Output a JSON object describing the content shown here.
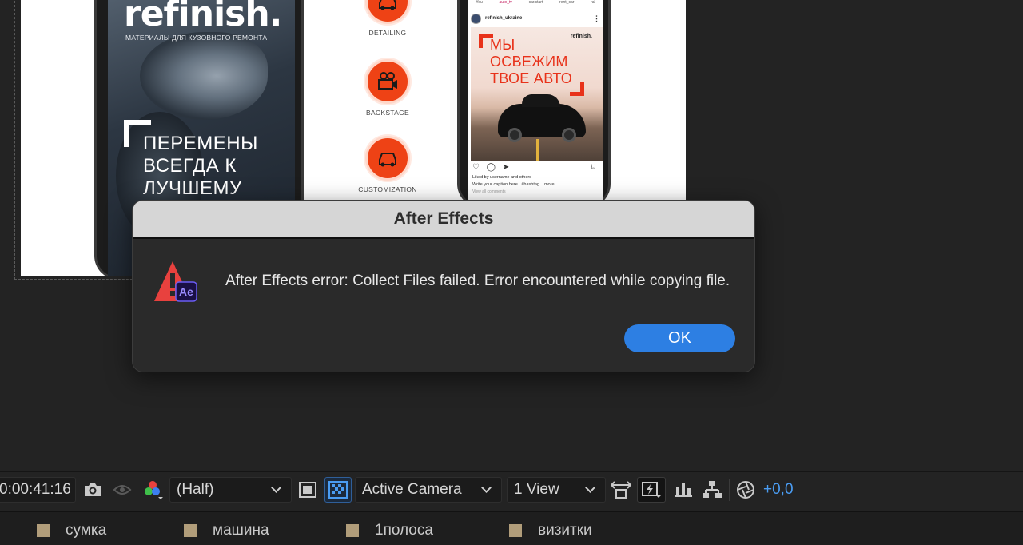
{
  "composition": {
    "phone1": {
      "brand": "refinish.",
      "subtitle": "МАТЕРИАЛЫ ДЛЯ КУЗОВНОГО РЕМОНТА",
      "slogan_lines": [
        "ПЕРЕМЕНЫ",
        "ВСЕГДА К",
        "ЛУЧШЕМУ"
      ]
    },
    "services": [
      {
        "label": "DETAILING",
        "icon": "car-icon"
      },
      {
        "label": "BACKSTAGE",
        "icon": "camera-icon"
      },
      {
        "label": "CUSTOMIZATION",
        "icon": "car-icon"
      }
    ],
    "phone2": {
      "stories": [
        "You",
        "auto_tv",
        "car.start",
        "rent_car",
        "ral"
      ],
      "account": "refinish_ukraine",
      "post_brand": "refinish.",
      "post_lines": [
        "МЫ",
        "ОСВЕЖИМ",
        "ТВОЕ АВТО"
      ],
      "liked_by": "Liked by username and others",
      "caption": "Write your caption here...#hashtag ...more",
      "comments": "View all comments"
    }
  },
  "dialog": {
    "title": "After Effects",
    "message": "After Effects error: Collect Files failed. Error encountered while copying file.",
    "ok_label": "OK",
    "icon": "warning-ae-icon",
    "icon_badge": "Ae"
  },
  "toolbar": {
    "timecode": "0:00:41:16",
    "resolution": "(Half)",
    "camera": "Active Camera",
    "views": "1 View",
    "exposure": "+0,0"
  },
  "comp_tabs": [
    {
      "label": "сумка"
    },
    {
      "label": "машина"
    },
    {
      "label": "1полоса"
    },
    {
      "label": "визитки"
    }
  ],
  "colors": {
    "accent_blue": "#2d7fe3",
    "alert_red": "#e8413e",
    "ae_badge": "#1a1045",
    "swatch": "#b19d7a"
  }
}
